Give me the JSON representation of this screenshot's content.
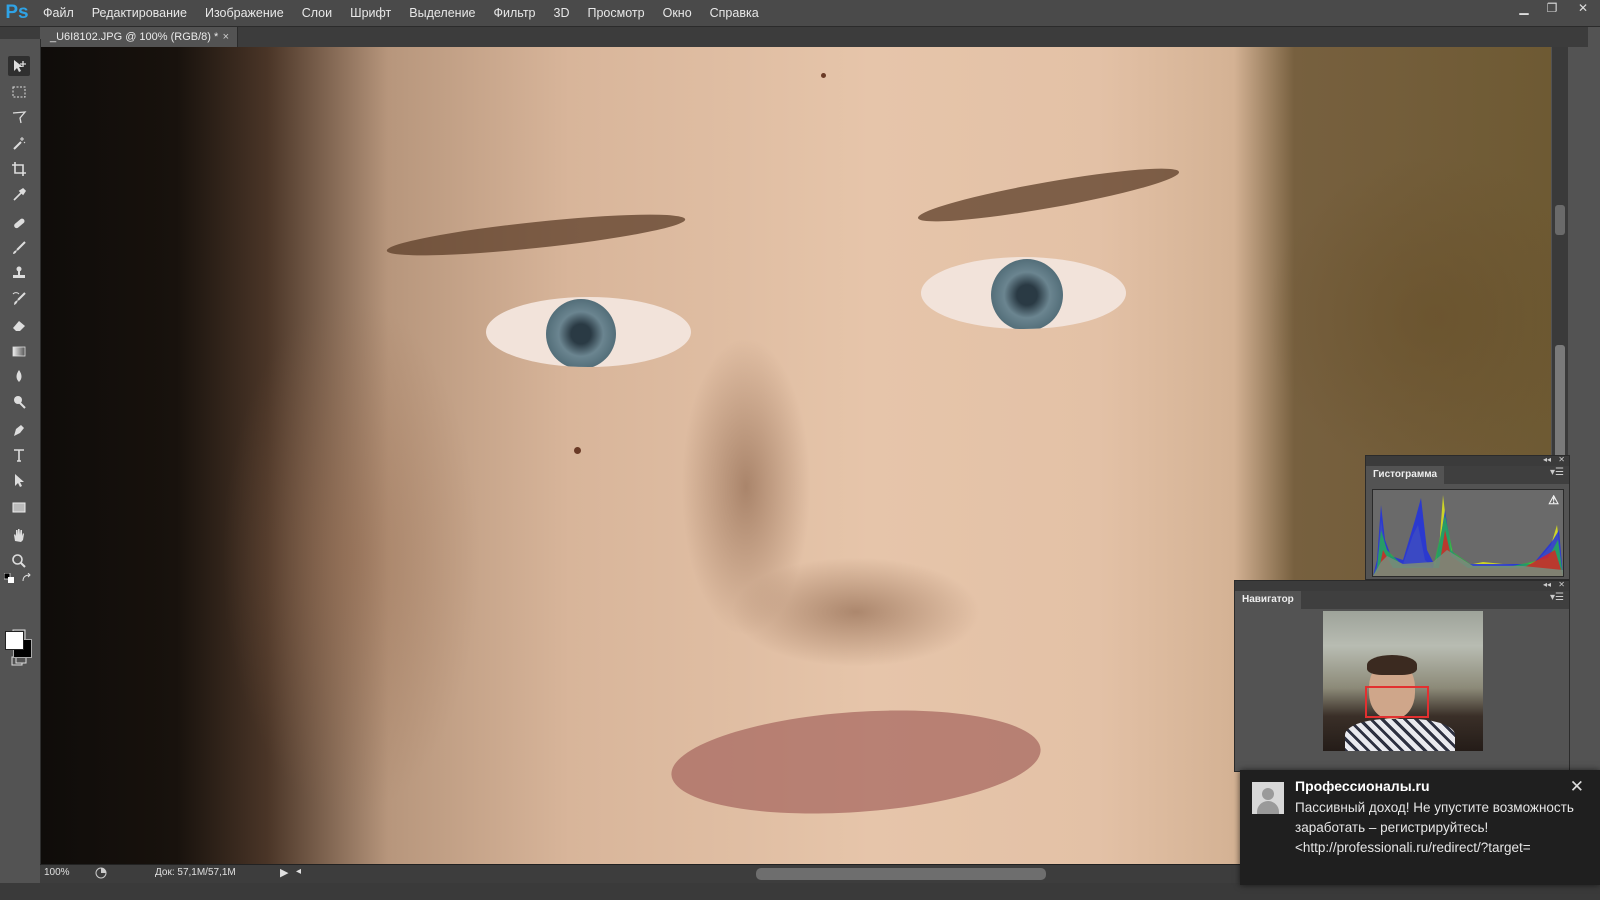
{
  "app": {
    "logo": "Ps"
  },
  "menu": [
    "Файл",
    "Редактирование",
    "Изображение",
    "Слои",
    "Шрифт",
    "Выделение",
    "Фильтр",
    "3D",
    "Просмотр",
    "Окно",
    "Справка"
  ],
  "window_controls": {
    "minimize": "▁",
    "restore": "❐",
    "close": "✕"
  },
  "document": {
    "tab_title": "_U6I8102.JPG @ 100% (RGB/8) *",
    "tab_close": "×"
  },
  "status": {
    "zoom": "100%",
    "doc_info": "Док: 57,1M/57,1M"
  },
  "panels": {
    "histogram": {
      "title": "Гистограмма",
      "warning": "⚠"
    },
    "navigator": {
      "title": "Навигатор"
    }
  },
  "notification": {
    "title": "Профессионалы.ru",
    "text": "Пассивный доход! Не упустите возможность заработать – регистрируйтесь! <http://professionali.ru/redirect/?target=",
    "close": "✕"
  },
  "colors": {
    "accent": "#2fa3e6",
    "navigator_box": "#e23030"
  }
}
